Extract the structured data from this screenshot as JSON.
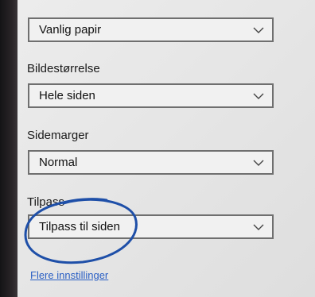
{
  "paper_type": {
    "value": "Vanlig papir"
  },
  "image_size": {
    "label": "Bildestørrelse",
    "value": "Hele siden"
  },
  "margins": {
    "label": "Sidemarger",
    "value": "Normal"
  },
  "fit": {
    "label": "Tilpass",
    "value": "Tilpass til siden"
  },
  "more_settings_link": "Flere innstillinger",
  "colors": {
    "link": "#2a5fc4",
    "annotation_ink": "#1e4fa8"
  }
}
